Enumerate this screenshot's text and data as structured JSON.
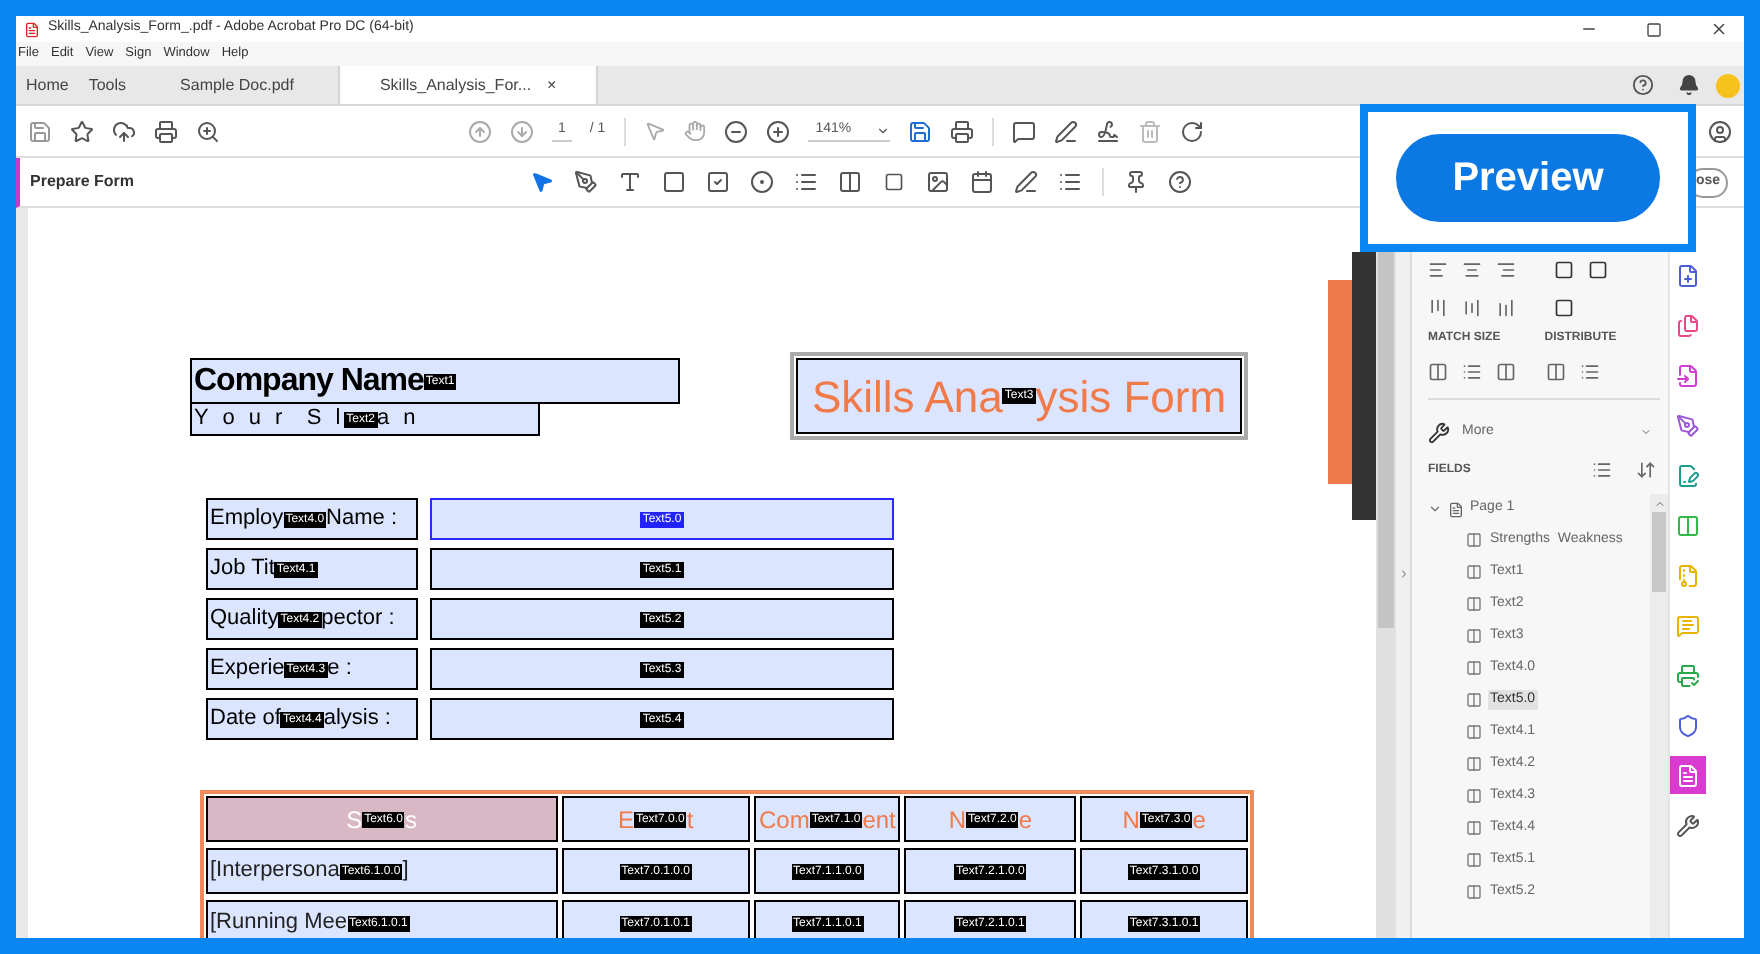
{
  "window": {
    "title": "Skills_Analysis_Form_.pdf - Adobe Acrobat Pro DC (64-bit)"
  },
  "menu": [
    "File",
    "Edit",
    "View",
    "Sign",
    "Window",
    "Help"
  ],
  "tabs": [
    {
      "label": "Home",
      "selected": false
    },
    {
      "label": "Tools",
      "selected": false
    },
    {
      "label": "Sample Doc.pdf",
      "selected": false
    },
    {
      "label": "Skills_Analysis_For...",
      "selected": true,
      "close": "×"
    }
  ],
  "toolbar": {
    "page": "1",
    "pages": "/ 1",
    "zoom": "141%"
  },
  "prepare_form": {
    "title": "Prepare Form",
    "close": "ose"
  },
  "preview_button": "Preview",
  "document": {
    "company": {
      "before": "Company Name",
      "tag": "Text1"
    },
    "slogan": {
      "before": "Y o u r  S l",
      "tag": "Text2",
      "after": "a n"
    },
    "title": {
      "before": "Skills Ana",
      "tag": "Text3",
      "after": "ysis Form"
    },
    "rows": [
      {
        "label": {
          "before": "Employ",
          "tag": "Text4.0",
          "after": "Name :"
        },
        "input": {
          "tag": "Text5.0",
          "selected": true
        }
      },
      {
        "label": {
          "before": "Job Tit",
          "tag": "Text4.1"
        },
        "input": {
          "tag": "Text5.1",
          "selected": false
        }
      },
      {
        "label": {
          "before": "Quality",
          "tag": "Text4.2",
          "after": "pector :"
        },
        "input": {
          "tag": "Text5.2",
          "selected": false
        }
      },
      {
        "label": {
          "before": "Experie",
          "tag": "Text4.3",
          "after": "e :"
        },
        "input": {
          "tag": "Text5.3",
          "selected": false
        }
      },
      {
        "label": {
          "before": "Date of",
          "tag": "Text4.4",
          "after": "alysis :"
        },
        "input": {
          "tag": "Text5.4",
          "selected": false
        }
      }
    ],
    "table": {
      "header": [
        {
          "before": "S",
          "tag": "Text6.0",
          "after": "s"
        },
        {
          "before": "E",
          "tag": "Text7.0.0",
          "after": "t"
        },
        {
          "before": "Com",
          "tag": "Text7.1.0",
          "after": "ent"
        },
        {
          "before": "N",
          "tag": "Text7.2.0",
          "after": "e"
        },
        {
          "before": "N",
          "tag": "Text7.3.0",
          "after": "e"
        }
      ],
      "rows": [
        [
          {
            "before": "[Interpersona",
            "tag": "Text6.1.0.0",
            "after": "]"
          },
          {
            "tag": "Text7.0.1.0.0"
          },
          {
            "tag": "Text7.1.1.0.0"
          },
          {
            "tag": "Text7.2.1.0.0"
          },
          {
            "tag": "Text7.3.1.0.0"
          }
        ],
        [
          {
            "before": "[Running Mee",
            "tag": "Text6.1.0.1"
          },
          {
            "tag": "Text7.0.1.0.1"
          },
          {
            "tag": "Text7.1.1.0.1"
          },
          {
            "tag": "Text7.2.1.0.1"
          },
          {
            "tag": "Text7.3.1.0.1"
          }
        ]
      ]
    }
  },
  "panel": {
    "match_size": "MATCH SIZE",
    "distribute": "DISTRIBUTE",
    "more": "More",
    "fields": "FIELDS",
    "page": "Page 1",
    "expanded": true,
    "items": [
      {
        "label": "Strengths  Weakness",
        "selected": false
      },
      {
        "label": "Text1",
        "selected": false
      },
      {
        "label": "Text2",
        "selected": false
      },
      {
        "label": "Text3",
        "selected": false
      },
      {
        "label": "Text4.0",
        "selected": false
      },
      {
        "label": "Text5.0",
        "selected": true
      },
      {
        "label": "Text4.1",
        "selected": false
      },
      {
        "label": "Text4.2",
        "selected": false
      },
      {
        "label": "Text4.3",
        "selected": false
      },
      {
        "label": "Text4.4",
        "selected": false
      },
      {
        "label": "Text5.1",
        "selected": false
      },
      {
        "label": "Text5.2",
        "selected": false
      }
    ]
  },
  "side_tools": [
    {
      "selected": false
    },
    {
      "selected": false
    },
    {
      "selected": false
    },
    {
      "selected": false
    },
    {
      "selected": false
    },
    {
      "selected": false
    },
    {
      "selected": false
    },
    {
      "selected": false
    },
    {
      "selected": false
    },
    {
      "selected": false
    },
    {
      "selected": true
    },
    {
      "selected": false
    }
  ]
}
